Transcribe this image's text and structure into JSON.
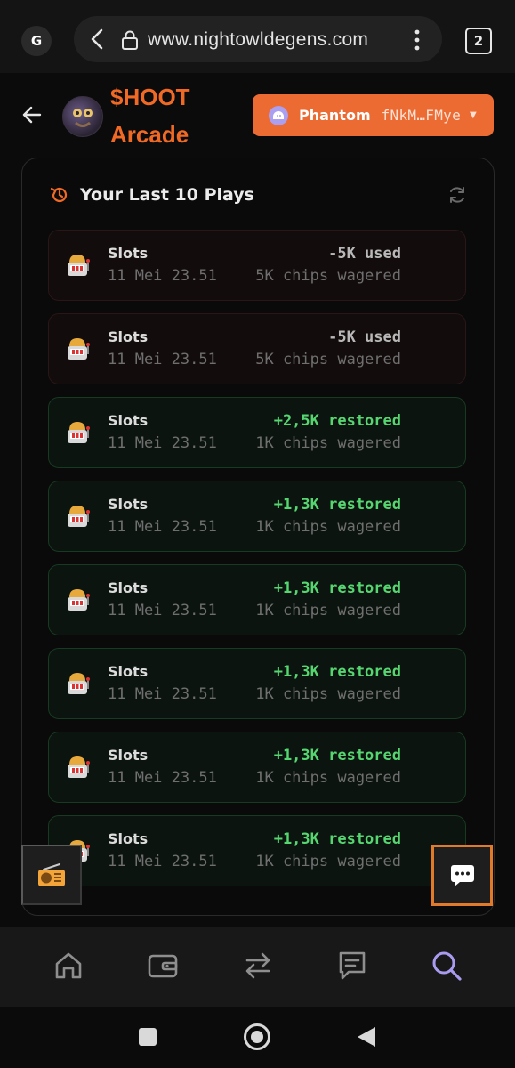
{
  "browser": {
    "profile_initial": "G",
    "url": "www.nightowldegens.com",
    "tab_count": "2"
  },
  "app": {
    "title_line1": "$HOOT",
    "title_line2": "Arcade",
    "wallet": {
      "name": "Phantom",
      "address": "fNkM…FMye"
    },
    "accent_color": "#ec6b33"
  },
  "history": {
    "title": "Your Last 10 Plays",
    "plays": [
      {
        "game": "Slots",
        "time": "11 Mei 23.51",
        "result": "-5K used",
        "wager": "5K chips wagered",
        "status": "used"
      },
      {
        "game": "Slots",
        "time": "11 Mei 23.51",
        "result": "-5K used",
        "wager": "5K chips wagered",
        "status": "used"
      },
      {
        "game": "Slots",
        "time": "11 Mei 23.51",
        "result": "+2,5K restored",
        "wager": "1K chips wagered",
        "status": "restored"
      },
      {
        "game": "Slots",
        "time": "11 Mei 23.51",
        "result": "+1,3K restored",
        "wager": "1K chips wagered",
        "status": "restored"
      },
      {
        "game": "Slots",
        "time": "11 Mei 23.51",
        "result": "+1,3K restored",
        "wager": "1K chips wagered",
        "status": "restored"
      },
      {
        "game": "Slots",
        "time": "11 Mei 23.51",
        "result": "+1,3K restored",
        "wager": "1K chips wagered",
        "status": "restored"
      },
      {
        "game": "Slots",
        "time": "11 Mei 23.51",
        "result": "+1,3K restored",
        "wager": "1K chips wagered",
        "status": "restored"
      },
      {
        "game": "Slots",
        "time": "11 Mei 23.51",
        "result": "+1,3K restored",
        "wager": "1K chips wagered",
        "status": "restored"
      }
    ]
  },
  "bottom_nav": {
    "items": [
      "home-icon",
      "wallet-icon",
      "swap-icon",
      "chat-icon",
      "search-icon"
    ],
    "active": "search-icon",
    "active_color": "#a99cf0"
  }
}
